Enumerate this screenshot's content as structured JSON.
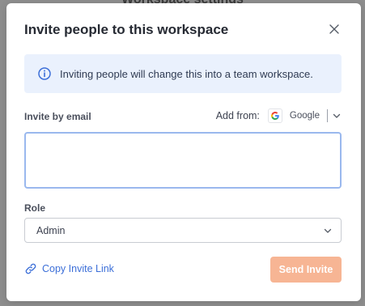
{
  "background": {
    "page_title": "Workspace settings"
  },
  "modal": {
    "title": "Invite people to this workspace",
    "info_banner": {
      "icon": "info-icon",
      "text": "Inviting people will change this into a team workspace."
    },
    "invite": {
      "label": "Invite by email",
      "add_from_label": "Add from:",
      "provider_letter": "G",
      "provider_label": "Google",
      "email_value": ""
    },
    "role": {
      "label": "Role",
      "selected": "Admin"
    },
    "copy_link_label": "Copy Invite Link",
    "send_label": "Send Invite"
  },
  "colors": {
    "accent_link": "#3c6fd8",
    "send_button_disabled": "#f7b594",
    "info_bg": "#eaf1fd",
    "input_focus_border": "#9ab8ee"
  }
}
